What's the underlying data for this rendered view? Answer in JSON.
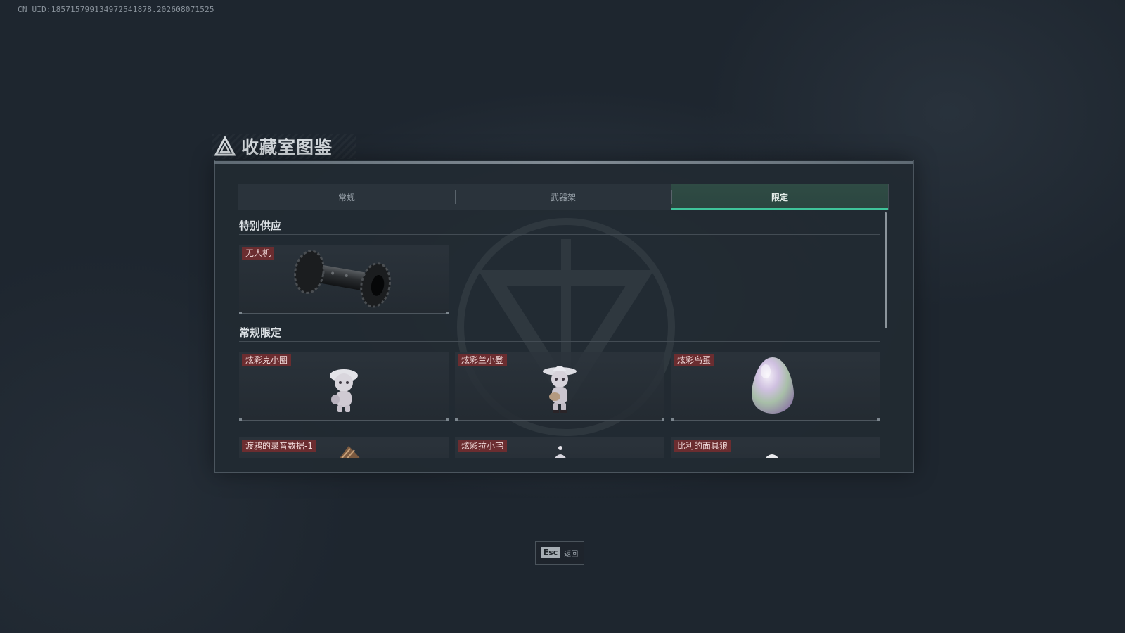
{
  "uid": "CN UID:185715799134972541878.202608071525",
  "title": "收藏室图鉴",
  "tabs": [
    {
      "label": "常规",
      "active": false
    },
    {
      "label": "武器架",
      "active": false
    },
    {
      "label": "限定",
      "active": true
    }
  ],
  "sections": [
    {
      "title": "特别供应",
      "items": [
        {
          "label": "无人机",
          "icon": "drone-icon"
        }
      ]
    },
    {
      "title": "常规限定",
      "items": [
        {
          "label": "炫彩克小圈",
          "icon": "figurine-icon"
        },
        {
          "label": "炫彩兰小登",
          "icon": "figurine-sombrero-icon"
        },
        {
          "label": "炫彩鸟蛋",
          "icon": "egg-icon"
        },
        {
          "label": "渡鸦的录音数据-1",
          "icon": "recorder-icon"
        },
        {
          "label": "炫彩拉小宅",
          "icon": "figurine-icon"
        },
        {
          "label": "比利的面具狼",
          "icon": "mask-icon"
        }
      ]
    }
  ],
  "footer": {
    "key": "Esc",
    "label": "返回"
  },
  "colors": {
    "accent": "#3fc49a",
    "tag_bg": "#6b2d30",
    "background": "#1e262f"
  }
}
